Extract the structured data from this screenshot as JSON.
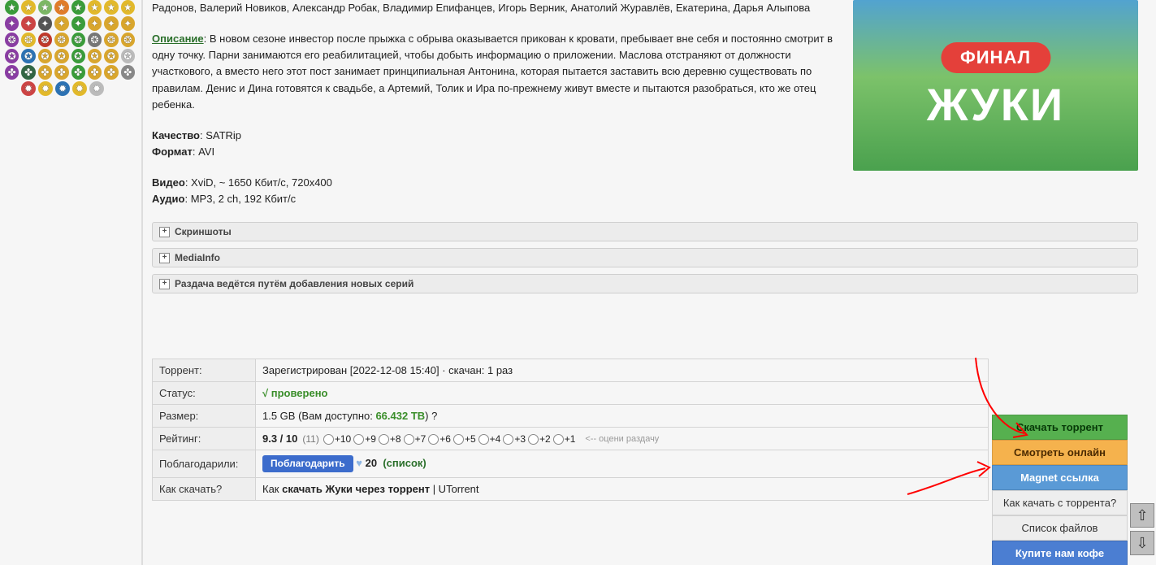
{
  "poster": {
    "pill": "ФИНАЛ",
    "title": "ЖУКИ"
  },
  "actors_line": "Радонов, Валерий Новиков, Александр Робак, Владимир Епифанцев, Игорь Верник, Анатолий Журавлёв, Екатерина, Дарья Алыпова",
  "description": {
    "label": "Описание",
    "text": ": В новом сезоне инвестор после прыжка с обрыва оказывается прикован к кровати, пребывает вне себя и постоянно смотрит в одну точку. Парни занимаются его реабилитацией, чтобы добыть информацию о приложении. Маслова отстраняют от должности участкового, а вместо него этот пост занимает принципиальная Антонина, которая пытается заставить всю деревню существовать по правилам. Денис и Дина готовятся к свадьбе, а Артемий, Толик и Ира по-прежнему живут вместе и пытаются разобраться, кто же отец ребенка."
  },
  "tech": {
    "quality_label": "Качество",
    "quality_value": ": SATRip",
    "format_label": "Формат",
    "format_value": ": AVI",
    "video_label": "Видео",
    "video_value": ": XviD, ~ 1650 Кбит/с, 720x400",
    "audio_label": "Аудио",
    "audio_value": ": MP3, 2 ch, 192 Кбит/с"
  },
  "spoilers": {
    "screens": "Скриншоты",
    "mediainfo": "MediaInfo",
    "adding": "Раздача ведётся путём добавления новых серий"
  },
  "table": {
    "torrent_label": "Торрент:",
    "torrent_value": "Зарегистрирован [2022-12-08 15:40] · скачан: 1 раз",
    "status_label": "Статус:",
    "status_value": "√ проверено",
    "size_label": "Размер:",
    "size_prefix": "1.5 GB (Вам доступно: ",
    "size_avail": "66.432 TB",
    "size_suffix": ") ?",
    "rating_label": "Рейтинг:",
    "rating_score": "9.3 / 10",
    "rating_count": "(11)",
    "rating_hint": "<-- оцени раздачу",
    "rating_options": [
      "+10",
      "+9",
      "+8",
      "+7",
      "+6",
      "+5",
      "+4",
      "+3",
      "+2",
      "+1"
    ],
    "thanks_label": "Поблагодарили:",
    "thanks_btn": "Поблагодарить",
    "thanks_heart": "♥",
    "thanks_count": "20",
    "thanks_list": "список",
    "howto_label": "Как скачать?",
    "howto_pre": "Как ",
    "howto_bold": "скачать Жуки через торрент",
    "howto_post": " | UTorrent"
  },
  "side_buttons": {
    "download": "Скачать торрент",
    "watch": "Смотреть онлайн",
    "magnet": "Magnet ссылка",
    "howto": "Как качать с торрента?",
    "filelist": "Список файлов",
    "donate": "Купите нам кофе"
  },
  "scroll": {
    "up": "⇧",
    "down": "⇩"
  }
}
